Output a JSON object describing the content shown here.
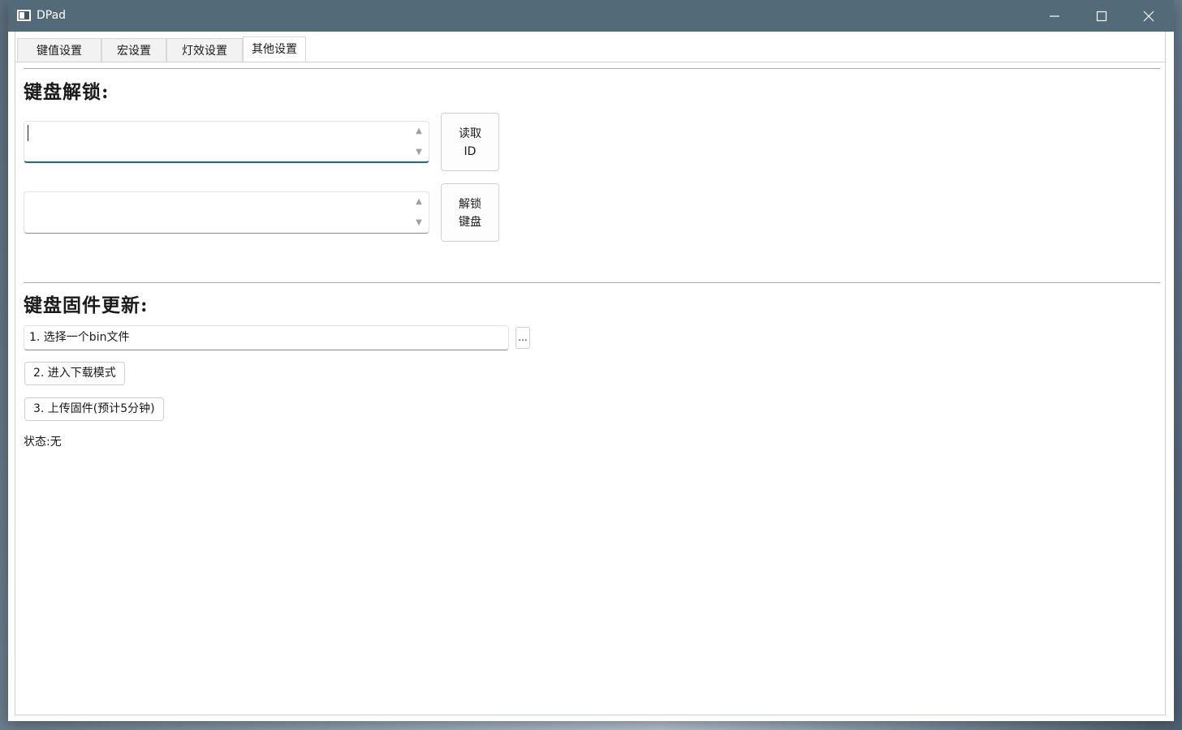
{
  "window": {
    "title": "DPad"
  },
  "tabs": [
    {
      "label": "键值设置"
    },
    {
      "label": "宏设置"
    },
    {
      "label": "灯效设置"
    },
    {
      "label": "其他设置"
    }
  ],
  "active_tab": "其他设置",
  "unlock": {
    "title": "键盘解锁:",
    "id_value": "",
    "key_value": "",
    "read_id_line1": "读取",
    "read_id_line2": "ID",
    "unlock_line1": "解锁",
    "unlock_line2": "键盘"
  },
  "firmware": {
    "title": "键盘固件更新:",
    "file_field": "1. 选择一个bin文件",
    "browse": "...",
    "download_mode": "2. 进入下载模式",
    "upload": "3. 上传固件(预计5分钟)",
    "status": "状态:无"
  },
  "icons": {
    "app": "app-window-icon",
    "minimize": "minimize-icon",
    "maximize": "maximize-icon",
    "close": "close-icon",
    "spin_up": "spin-up-arrow-icon",
    "spin_down": "spin-down-arrow-icon"
  },
  "colors": {
    "titlebar": "#536a79",
    "focus_accent": "#1a63b8"
  }
}
